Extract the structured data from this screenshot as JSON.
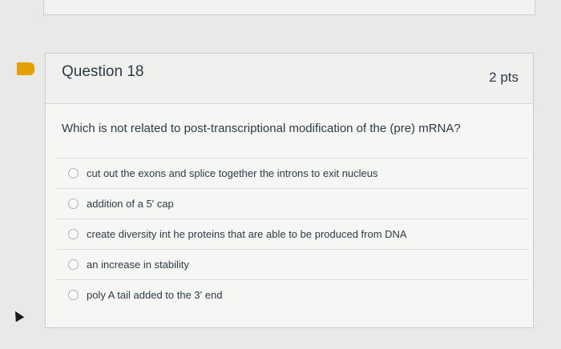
{
  "question": {
    "title": "Question 18",
    "points": "2 pts",
    "text": "Which is not related to post-transcriptional modification of the (pre) mRNA?",
    "answers": [
      {
        "label": "cut out the exons and splice together the introns to exit nucleus"
      },
      {
        "label": "addition of a 5' cap"
      },
      {
        "label": "create diversity int he proteins that are able to be produced from DNA"
      },
      {
        "label": "an increase in stability"
      },
      {
        "label": "poly A tail added to the 3' end"
      }
    ]
  },
  "colors": {
    "flag": "#e5a000",
    "text": "#2d3b45",
    "border": "#c7cdd1",
    "background": "#e9e9e7"
  },
  "icons": {
    "flag": "bookmark-flag-icon",
    "cursor": "mouse-pointer-icon"
  }
}
